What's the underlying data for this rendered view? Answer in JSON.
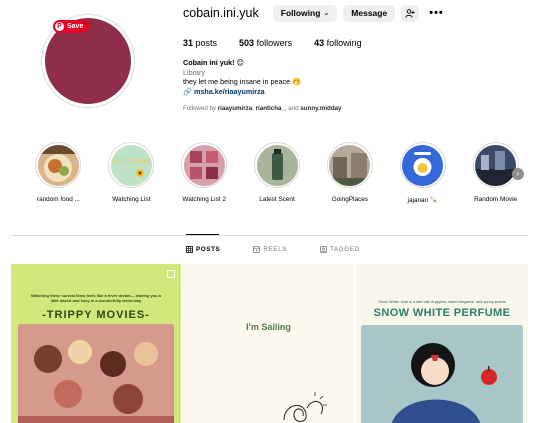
{
  "profile": {
    "username": "cobain.ini.yuk",
    "save_badge": "Save",
    "following_button": "Following",
    "message_button": "Message",
    "more_icon": "more-horizontal-icon",
    "stats": {
      "posts_count": "31",
      "posts_label": "posts",
      "followers_count": "503",
      "followers_label": "followers",
      "following_count": "43",
      "following_label": "following"
    },
    "bio": {
      "name": "Cobain ini yuk! 😊",
      "category": "Library",
      "text": "they let me being insane in peace 🤭",
      "link": "msha.ke/riaayumirza"
    },
    "followed_by": {
      "prefix": "Followed by",
      "user1": "riaayumirza",
      "user2": "rianticha_",
      "separator": ", and",
      "user3": "sunny.midday"
    },
    "avatar_color": "#8e2e48"
  },
  "highlights": [
    {
      "label": "random food ...",
      "color": "#c4925b"
    },
    {
      "label": "Watching List",
      "color": "#bfe2c7"
    },
    {
      "label": "Watching List 2",
      "color": "#c97a86"
    },
    {
      "label": "Latest Scent",
      "color": "#5c7a5e"
    },
    {
      "label": "GoingPlaces",
      "color": "#8a8378"
    },
    {
      "label": "jajanan 🍡",
      "color": "#3567d8"
    },
    {
      "label": "Random Movie",
      "color": "#3c4a66"
    }
  ],
  "highlight_badge_1": "watching list",
  "tabs": [
    {
      "label": "POSTS",
      "icon": "grid-icon",
      "active": true
    },
    {
      "label": "REELS",
      "icon": "reels-icon",
      "active": false
    },
    {
      "label": "TAGGED",
      "icon": "tagged-icon",
      "active": false
    }
  ],
  "posts": {
    "p1_small": "Watching these surreal films feels like a fever dream— leaving you a little dazed and hazy in a wonderfully weird way",
    "p1_title": "-TRIPPY MOVIES-",
    "p2_text": "I'm Sailing",
    "p3_small": "Snow White: core in a tale tale of apples, warm elegance, and sunny scents",
    "p3_title": "SNOW WHITE PERFUME"
  }
}
